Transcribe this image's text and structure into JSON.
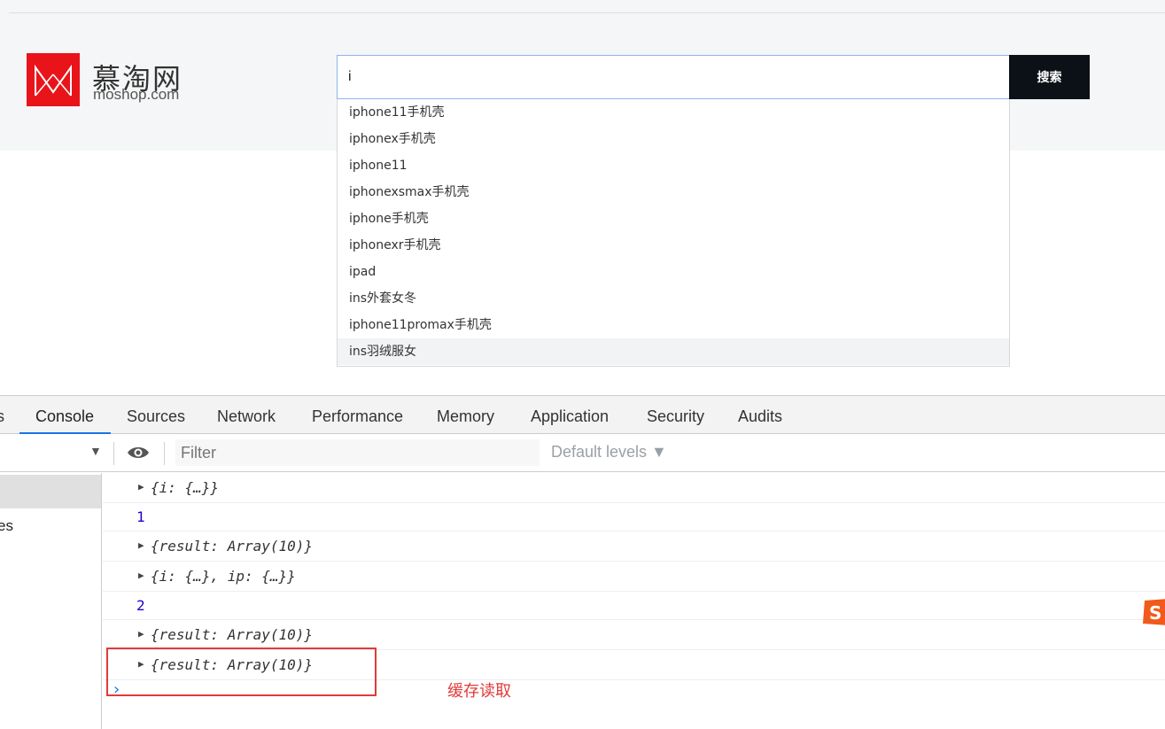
{
  "brand": {
    "title": "慕淘网",
    "subtitle": "moshop.com",
    "logo_color": "#e8141a"
  },
  "search": {
    "value": "i",
    "button_label": "搜索",
    "suggestions": [
      "iphone11手机壳",
      "iphonex手机壳",
      "iphone11",
      "iphonexsmax手机壳",
      "iphone手机壳",
      "iphonexr手机壳",
      "ipad",
      "ins外套女冬",
      "iphone11promax手机壳",
      "ins羽绒服女"
    ]
  },
  "devtools": {
    "tab_cut": "s",
    "tabs": [
      "Console",
      "Sources",
      "Network",
      "Performance",
      "Memory",
      "Application",
      "Security",
      "Audits"
    ],
    "active_tab": "Console",
    "filter_placeholder": "Filter",
    "levels_label": "Default levels ▼",
    "sidebar_item": "es",
    "console_rows": [
      {
        "kind": "object",
        "text": "{i: {…}}"
      },
      {
        "kind": "number",
        "text": "1"
      },
      {
        "kind": "object",
        "text": "{result: Array(10)}"
      },
      {
        "kind": "object",
        "text": "{i: {…}, ip: {…}}"
      },
      {
        "kind": "number",
        "text": "2"
      },
      {
        "kind": "object",
        "text": "{result: Array(10)}"
      },
      {
        "kind": "object",
        "text": "{result: Array(10)}"
      }
    ],
    "prompt": "›"
  },
  "annotation": {
    "text": "缓存读取",
    "color": "#e13a3a"
  }
}
